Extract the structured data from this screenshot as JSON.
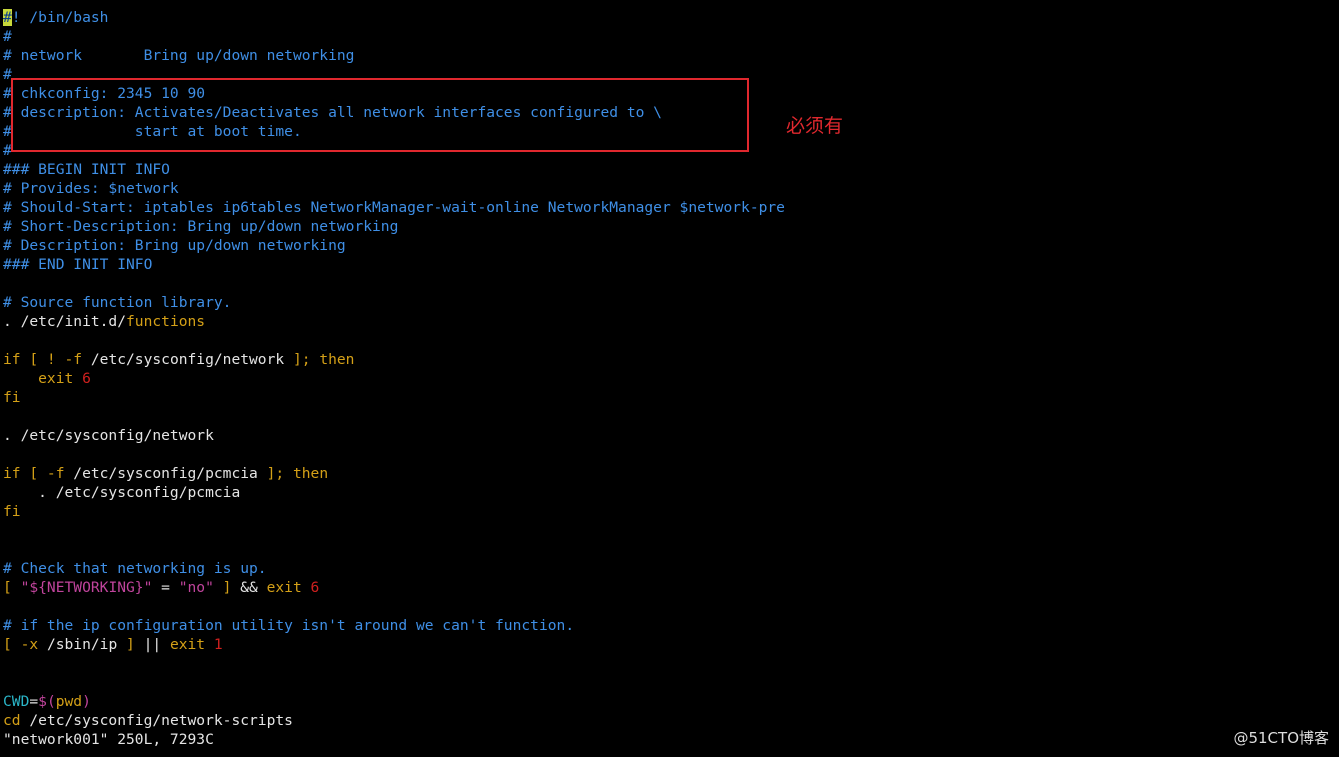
{
  "colors": {
    "comment": "#3f8fe6",
    "keyword": "#d4a017",
    "string": "#c0449c",
    "number": "#d0201e",
    "variable": "#2ab5c8",
    "text": "#e5e5e5",
    "status": "#e5e5e5"
  },
  "lines": [
    [
      {
        "t": "#",
        "c": "cursor"
      },
      {
        "t": "! /bin/bash",
        "c": "comment"
      }
    ],
    [
      {
        "t": "#",
        "c": "comment"
      }
    ],
    [
      {
        "t": "# network       Bring up/down networking",
        "c": "comment"
      }
    ],
    [
      {
        "t": "#",
        "c": "comment"
      }
    ],
    [
      {
        "t": "# chkconfig: 2345 10 90",
        "c": "comment"
      }
    ],
    [
      {
        "t": "# description: Activates/Deactivates all network interfaces configured to \\",
        "c": "comment"
      }
    ],
    [
      {
        "t": "#              start at boot time.",
        "c": "comment"
      }
    ],
    [
      {
        "t": "#",
        "c": "comment"
      }
    ],
    [
      {
        "t": "### BEGIN INIT INFO",
        "c": "comment"
      }
    ],
    [
      {
        "t": "# Provides: $network",
        "c": "comment"
      }
    ],
    [
      {
        "t": "# Should-Start: iptables ip6tables NetworkManager-wait-online NetworkManager $network-pre",
        "c": "comment"
      }
    ],
    [
      {
        "t": "# Short-Description: Bring up/down networking",
        "c": "comment"
      }
    ],
    [
      {
        "t": "# Description: Bring up/down networking",
        "c": "comment"
      }
    ],
    [
      {
        "t": "### END INIT INFO",
        "c": "comment"
      }
    ],
    [],
    [
      {
        "t": "# Source function library.",
        "c": "comment"
      }
    ],
    [
      {
        "t": ". /etc/init.d/",
        "c": "text"
      },
      {
        "t": "functions",
        "c": "keyword"
      }
    ],
    [],
    [
      {
        "t": "if [ ! -f ",
        "c": "keyword"
      },
      {
        "t": "/etc/sysconfig/network",
        "c": "text"
      },
      {
        "t": " ]; then",
        "c": "keyword"
      }
    ],
    [
      {
        "t": "    exit ",
        "c": "keyword"
      },
      {
        "t": "6",
        "c": "number"
      }
    ],
    [
      {
        "t": "fi",
        "c": "keyword"
      }
    ],
    [],
    [
      {
        "t": ". /etc/sysconfig/network",
        "c": "text"
      }
    ],
    [],
    [
      {
        "t": "if [ -f ",
        "c": "keyword"
      },
      {
        "t": "/etc/sysconfig/pcmcia",
        "c": "text"
      },
      {
        "t": " ]; then",
        "c": "keyword"
      }
    ],
    [
      {
        "t": "    . /etc/sysconfig/pcmcia",
        "c": "text"
      }
    ],
    [
      {
        "t": "fi",
        "c": "keyword"
      }
    ],
    [],
    [],
    [
      {
        "t": "# Check that networking is up.",
        "c": "comment"
      }
    ],
    [
      {
        "t": "[ ",
        "c": "keyword"
      },
      {
        "t": "\"${NETWORKING}\"",
        "c": "string"
      },
      {
        "t": " = ",
        "c": "text"
      },
      {
        "t": "\"no\"",
        "c": "string"
      },
      {
        "t": " ] ",
        "c": "keyword"
      },
      {
        "t": "&& ",
        "c": "text"
      },
      {
        "t": "exit ",
        "c": "keyword"
      },
      {
        "t": "6",
        "c": "number"
      }
    ],
    [],
    [
      {
        "t": "# if the ip configuration utility isn't around we can't function.",
        "c": "comment"
      }
    ],
    [
      {
        "t": "[ -x ",
        "c": "keyword"
      },
      {
        "t": "/sbin/ip",
        "c": "text"
      },
      {
        "t": " ] ",
        "c": "keyword"
      },
      {
        "t": "|| ",
        "c": "text"
      },
      {
        "t": "exit ",
        "c": "keyword"
      },
      {
        "t": "1",
        "c": "number"
      }
    ],
    [],
    [],
    [
      {
        "t": "CWD",
        "c": "variable"
      },
      {
        "t": "=",
        "c": "text"
      },
      {
        "t": "$(",
        "c": "string"
      },
      {
        "t": "pwd",
        "c": "keyword"
      },
      {
        "t": ")",
        "c": "string"
      }
    ],
    [
      {
        "t": "cd ",
        "c": "keyword"
      },
      {
        "t": "/etc/sysconfig/network-scripts",
        "c": "text"
      }
    ],
    [
      {
        "t": "\"network001\" 250L, 7293C",
        "c": "status"
      }
    ]
  ],
  "annotation": "必须有",
  "watermark": "@51CTO博客"
}
